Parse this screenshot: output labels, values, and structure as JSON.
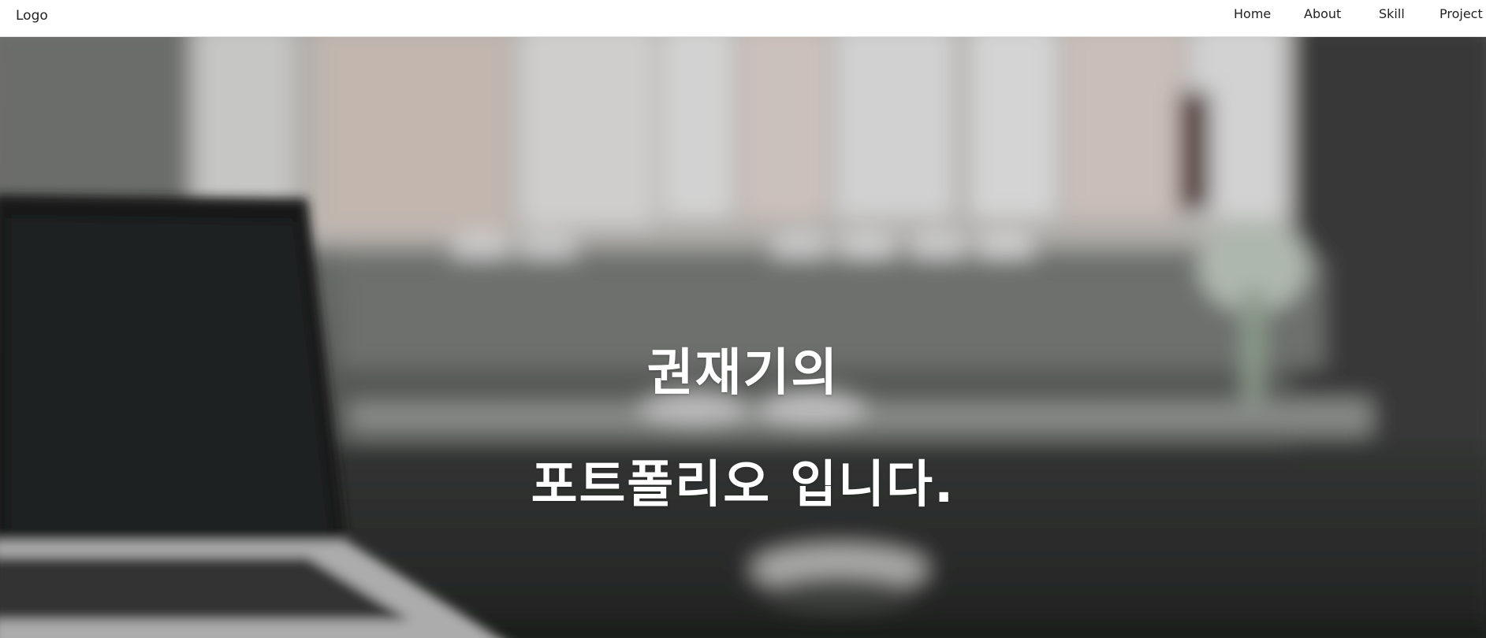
{
  "header": {
    "logo": "Logo",
    "nav": {
      "home": "Home",
      "about": "About",
      "skill": "Skill",
      "project": "Project"
    }
  },
  "hero": {
    "title_line1": "권재기의",
    "title_line2": "포트폴리오 입니다.",
    "background": "blurred-desk-photo",
    "overlay_color": "#2f3230"
  }
}
